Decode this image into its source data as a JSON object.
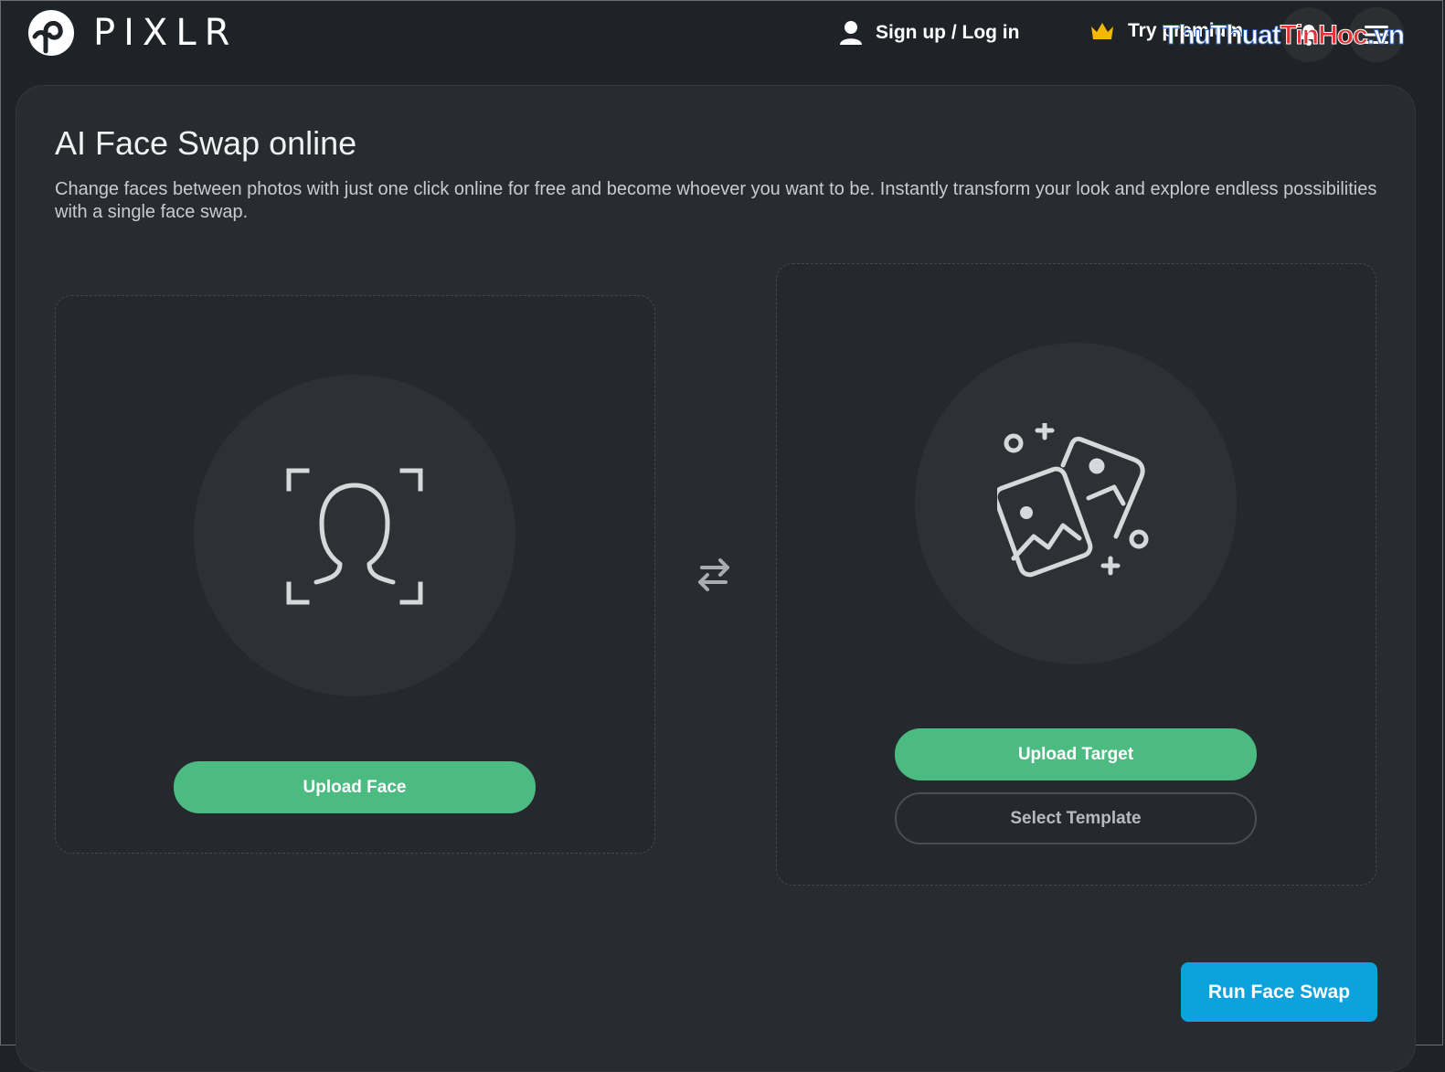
{
  "header": {
    "logo_text": "PIXLR",
    "auth_label": "Sign up / Log in",
    "premium_label": "Try premium",
    "watermark": {
      "part_a": "ThuThuat",
      "part_b": "TinHoc",
      "part_c": ".vn"
    }
  },
  "page": {
    "title": "AI Face Swap online",
    "description": "Change faces between photos with just one click online for free and become whoever you want to be. Instantly transform your look and explore endless possibilities with a single face swap."
  },
  "face_card": {
    "upload_label": "Upload Face"
  },
  "target_card": {
    "upload_label": "Upload Target",
    "template_label": "Select Template"
  },
  "run_label": "Run Face Swap",
  "colors": {
    "background": "#1f2226",
    "panel": "#282b30",
    "accent_green": "#4bbb82",
    "accent_blue": "#0ea2dd",
    "crown": "#f5b700"
  }
}
